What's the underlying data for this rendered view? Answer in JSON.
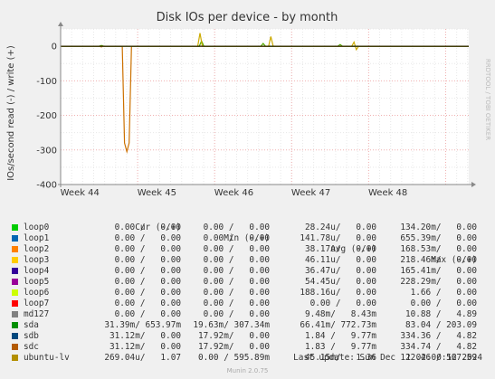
{
  "chart_data": {
    "type": "line",
    "title": "Disk IOs per device - by month",
    "ylabel": "IOs/second read (-) / write (+)",
    "ylim": [
      -400,
      50
    ],
    "yticks": [
      0,
      -100,
      -200,
      -300,
      -400
    ],
    "xlim": [
      0,
      5.3
    ],
    "xticks": [
      {
        "x": 0.25,
        "label": "Week 44"
      },
      {
        "x": 1.25,
        "label": "Week 45"
      },
      {
        "x": 2.25,
        "label": "Week 46"
      },
      {
        "x": 3.25,
        "label": "Week 47"
      },
      {
        "x": 4.25,
        "label": "Week 48"
      }
    ],
    "grid": true,
    "series": [
      {
        "name": "sdc",
        "color": "#cc7000",
        "points": [
          [
            0.0,
            0
          ],
          [
            0.5,
            0
          ],
          [
            0.53,
            -2
          ],
          [
            0.55,
            0
          ],
          [
            0.8,
            0
          ],
          [
            0.83,
            -280
          ],
          [
            0.86,
            -305
          ],
          [
            0.89,
            -280
          ],
          [
            0.92,
            0
          ],
          [
            5.3,
            0
          ]
        ]
      },
      {
        "name": "sda",
        "color": "#55aa00",
        "points": [
          [
            0.0,
            0
          ],
          [
            0.5,
            0
          ],
          [
            0.53,
            2
          ],
          [
            0.56,
            0
          ],
          [
            1.8,
            0
          ],
          [
            1.83,
            15
          ],
          [
            1.86,
            0
          ],
          [
            2.6,
            0
          ],
          [
            2.63,
            8
          ],
          [
            2.66,
            0
          ],
          [
            3.6,
            0
          ],
          [
            3.63,
            5
          ],
          [
            3.66,
            0
          ],
          [
            5.3,
            0
          ]
        ]
      },
      {
        "name": "ubuntu-lv",
        "color": "#ccaa00",
        "points": [
          [
            0.0,
            0
          ],
          [
            1.78,
            0
          ],
          [
            1.81,
            38
          ],
          [
            1.84,
            0
          ],
          [
            2.7,
            0
          ],
          [
            2.73,
            28
          ],
          [
            2.76,
            0
          ],
          [
            3.78,
            0
          ],
          [
            3.81,
            12
          ],
          [
            3.84,
            -10
          ],
          [
            3.87,
            0
          ],
          [
            5.3,
            0
          ]
        ]
      }
    ]
  },
  "side_label": "RRDTOOL / TOBI OETIKER",
  "legend": {
    "headers": {
      "cur": "Cur (-/+)",
      "min": "Min (-/+)",
      "avg": "Avg (-/+)",
      "max": "Max (-/+)"
    },
    "rows": [
      {
        "name": "loop0",
        "color": "#00cc00",
        "cur": "0.00 /   0.00",
        "min": "0.00 /   0.00",
        "avg": "28.24u/   0.00",
        "max": "134.20m/   0.00"
      },
      {
        "name": "loop1",
        "color": "#0066b3",
        "cur": "0.00 /   0.00",
        "min": "0.00 /   0.00",
        "avg": "141.78u/   0.00",
        "max": "655.39m/   0.00"
      },
      {
        "name": "loop2",
        "color": "#ff8000",
        "cur": "0.00 /   0.00",
        "min": "0.00 /   0.00",
        "avg": "38.17u/   0.00",
        "max": "168.53m/   0.00"
      },
      {
        "name": "loop3",
        "color": "#ffcc00",
        "cur": "0.00 /   0.00",
        "min": "0.00 /   0.00",
        "avg": "46.11u/   0.00",
        "max": "218.46m/   0.00"
      },
      {
        "name": "loop4",
        "color": "#330099",
        "cur": "0.00 /   0.00",
        "min": "0.00 /   0.00",
        "avg": "36.47u/   0.00",
        "max": "165.41m/   0.00"
      },
      {
        "name": "loop5",
        "color": "#990099",
        "cur": "0.00 /   0.00",
        "min": "0.00 /   0.00",
        "avg": "54.45u/   0.00",
        "max": "228.29m/   0.00"
      },
      {
        "name": "loop6",
        "color": "#ccff00",
        "cur": "0.00 /   0.00",
        "min": "0.00 /   0.00",
        "avg": "188.16u/   0.00",
        "max": "1.66 /   0.00"
      },
      {
        "name": "loop7",
        "color": "#ff0000",
        "cur": "0.00 /   0.00",
        "min": "0.00 /   0.00",
        "avg": "0.00 /   0.00",
        "max": "0.00 /   0.00"
      },
      {
        "name": "md127",
        "color": "#808080",
        "cur": "0.00 /   0.00",
        "min": "0.00 /   0.00",
        "avg": "9.48m/   8.43m",
        "max": "10.88 /   4.89"
      },
      {
        "name": "sda",
        "color": "#008f00",
        "cur": "31.39m/ 653.97m",
        "min": "19.63m/ 307.34m",
        "avg": "66.41m/ 772.73m",
        "max": "83.04 / 203.09"
      },
      {
        "name": "sdb",
        "color": "#00487d",
        "cur": "31.12m/   0.00",
        "min": "17.92m/   0.00",
        "avg": "1.84 /   9.77m",
        "max": "334.36 /   4.82"
      },
      {
        "name": "sdc",
        "color": "#b35a00",
        "cur": "31.12m/   0.00",
        "min": "17.92m/   0.00",
        "avg": "1.83 /   9.77m",
        "max": "334.74 /   4.82"
      },
      {
        "name": "ubuntu-lv",
        "color": "#b38f00",
        "cur": "269.04u/   1.07",
        "min": "0.00 / 595.89m",
        "avg": "45.15m/   1.36",
        "max": "122.46 / 567.59"
      }
    ]
  },
  "last_update": "Last update: Sun Dec  1 02:00:12 2024",
  "footer": "Munin 2.0.75"
}
